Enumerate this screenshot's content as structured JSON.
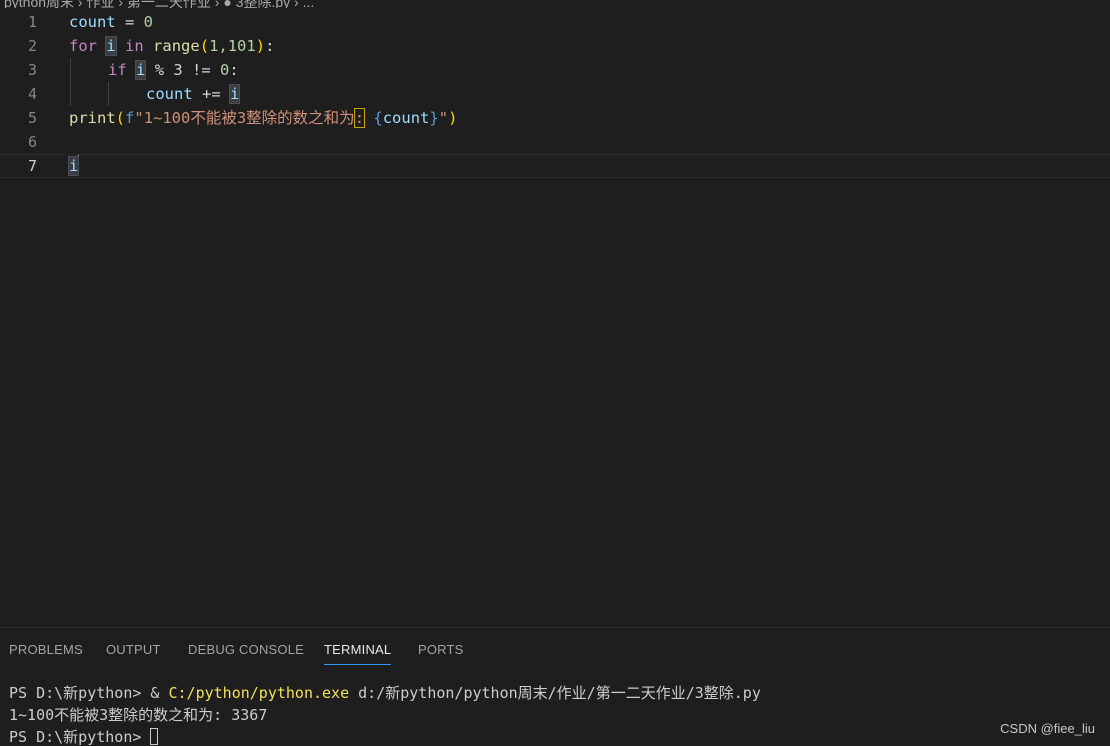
{
  "breadcrumb": {
    "text": "python周末 › 作业 › 第一二天作业 › ● 3整除.py › ..."
  },
  "editor": {
    "line_numbers": [
      "1",
      "2",
      "3",
      "4",
      "5",
      "6",
      "7"
    ],
    "line1": {
      "var": "count",
      "op": " = ",
      "num": "0"
    },
    "line2": {
      "kw": "for",
      "sp1": " ",
      "var": "i",
      "sp2": " ",
      "kw_in": "in",
      "sp3": " ",
      "fn": "range",
      "open": "(",
      "args": "1,101",
      "close": ")",
      "colon": ":"
    },
    "line3": {
      "kw": "if",
      "sp1": " ",
      "var": "i",
      "rest": " % 3 != ",
      "num": "0",
      "colon": ":"
    },
    "line4": {
      "var": "count",
      "op": " += ",
      "var2": "i"
    },
    "line5": {
      "fn": "print",
      "open": "(",
      "prefix": "f",
      "str": "\"1~100不能被3整除的数之和为",
      "colon": ":",
      "sp": " ",
      "brace_open": "{",
      "var": "count",
      "brace_close": "}",
      "quote": "\"",
      "close": ")"
    },
    "line7": {
      "var": "i"
    }
  },
  "panel": {
    "tabs": [
      "PROBLEMS",
      "OUTPUT",
      "DEBUG CONSOLE",
      "TERMINAL",
      "PORTS"
    ],
    "active_tab": "TERMINAL",
    "terminal": {
      "line1_prompt": "PS D:\\新python> & ",
      "line1_exe": "C:/python/python.exe",
      "line1_args": " d:/新python/python周末/作业/第一二天作业/3整除.py",
      "line2": "1~100不能被3整除的数之和为: 3367",
      "line3_prompt": "PS D:\\新python> "
    }
  },
  "watermark": "CSDN @fiee_liu",
  "colors": {
    "background": "#1e1e1e",
    "keyword_blue": "#569cd6",
    "keyword_purple": "#c586c0",
    "variable": "#9cdcfe",
    "number": "#b5cea8",
    "function": "#dcdcaa",
    "string": "#ce9178",
    "active_tab_underline": "#3794ff"
  }
}
